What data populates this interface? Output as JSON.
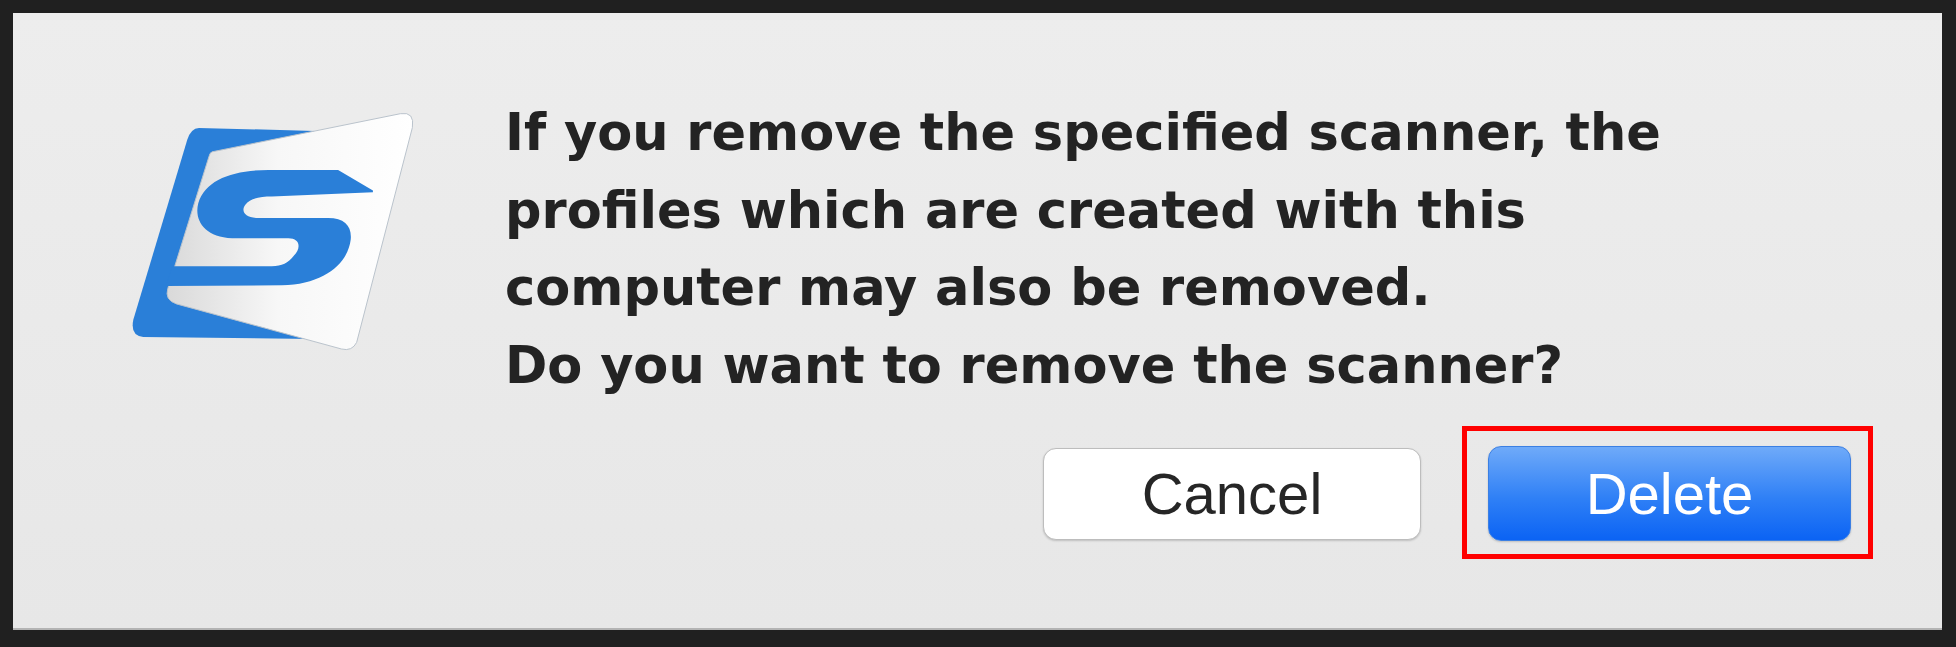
{
  "dialog": {
    "message": "If you remove the specified scanner, the profiles which are created with this computer may also be removed.",
    "question": "Do you want to remove the scanner?"
  },
  "buttons": [
    {
      "label": "Cancel",
      "default": false,
      "highlighted": false
    },
    {
      "label": "Delete",
      "default": true,
      "highlighted": true
    }
  ]
}
